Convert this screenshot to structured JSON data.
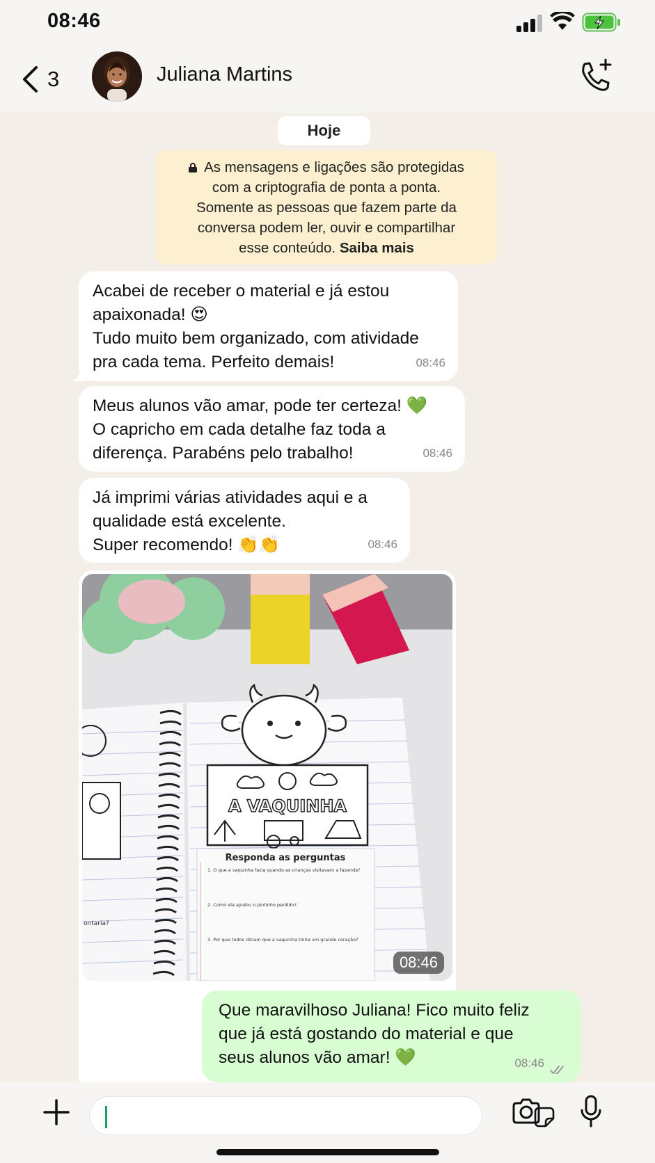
{
  "status_bar": {
    "time": "08:46"
  },
  "header": {
    "back_count": "3",
    "contact_name": "Juliana Martins"
  },
  "chat": {
    "date_chip": "Hoje",
    "encryption_notice": {
      "lines": [
        "As mensagens e ligações são protegidas",
        "com a criptografia de ponta a ponta.",
        "Somente as pessoas que fazem parte da",
        "conversa podem ler, ouvir e compartilhar"
      ],
      "last_line": "esse conteúdo.",
      "link": "Saiba mais"
    },
    "incoming": [
      {
        "lines": [
          "Acabei de receber o material e já estou",
          "apaixonada! 😍",
          "Tudo muito bem organizado, com atividade",
          "pra cada tema. Perfeito demais!"
        ],
        "time": "08:46"
      },
      {
        "lines": [
          "Meus alunos vão amar, pode ter certeza! 💚",
          "O capricho em cada detalhe faz toda a",
          "diferença. Parabéns pelo trabalho!"
        ],
        "time": "08:46"
      },
      {
        "lines": [
          "Já imprimi várias atividades aqui e a",
          "qualidade está excelente.",
          "Super recomendo! 👏👏"
        ],
        "time": "08:46"
      }
    ],
    "image_message": {
      "time": "08:46",
      "page_title": "A VAQUINHA",
      "worksheet_heading": "Responda as perguntas",
      "questions": [
        "1. O que a vaquinha fazia quando as crianças visitavam a fazenda?",
        "2. Como ela ajudou o pintinho perdido?",
        "3. Por que todos diziam que a vaquinha tinha um grande coração?"
      ],
      "left_page_fragment": "ontaria?"
    },
    "outgoing": {
      "lines": [
        "Que maravilhoso Juliana! Fico muito feliz",
        "que já está gostando do material e que",
        "seus alunos vão amar! 💚"
      ],
      "time": "08:46"
    }
  },
  "colors": {
    "outgoing_bubble": "#d9fdd3",
    "incoming_bubble": "#ffffff",
    "encryption_box": "#fcf0d1",
    "chat_background": "#f3eee7",
    "accent_green": "#1aa35d"
  },
  "icons": [
    "back-chevron-icon",
    "signal-icon",
    "wifi-icon",
    "battery-charging-icon",
    "add-call-icon",
    "lock-icon",
    "plus-icon",
    "sticker-icon",
    "camera-icon",
    "microphone-icon",
    "double-check-icon"
  ]
}
